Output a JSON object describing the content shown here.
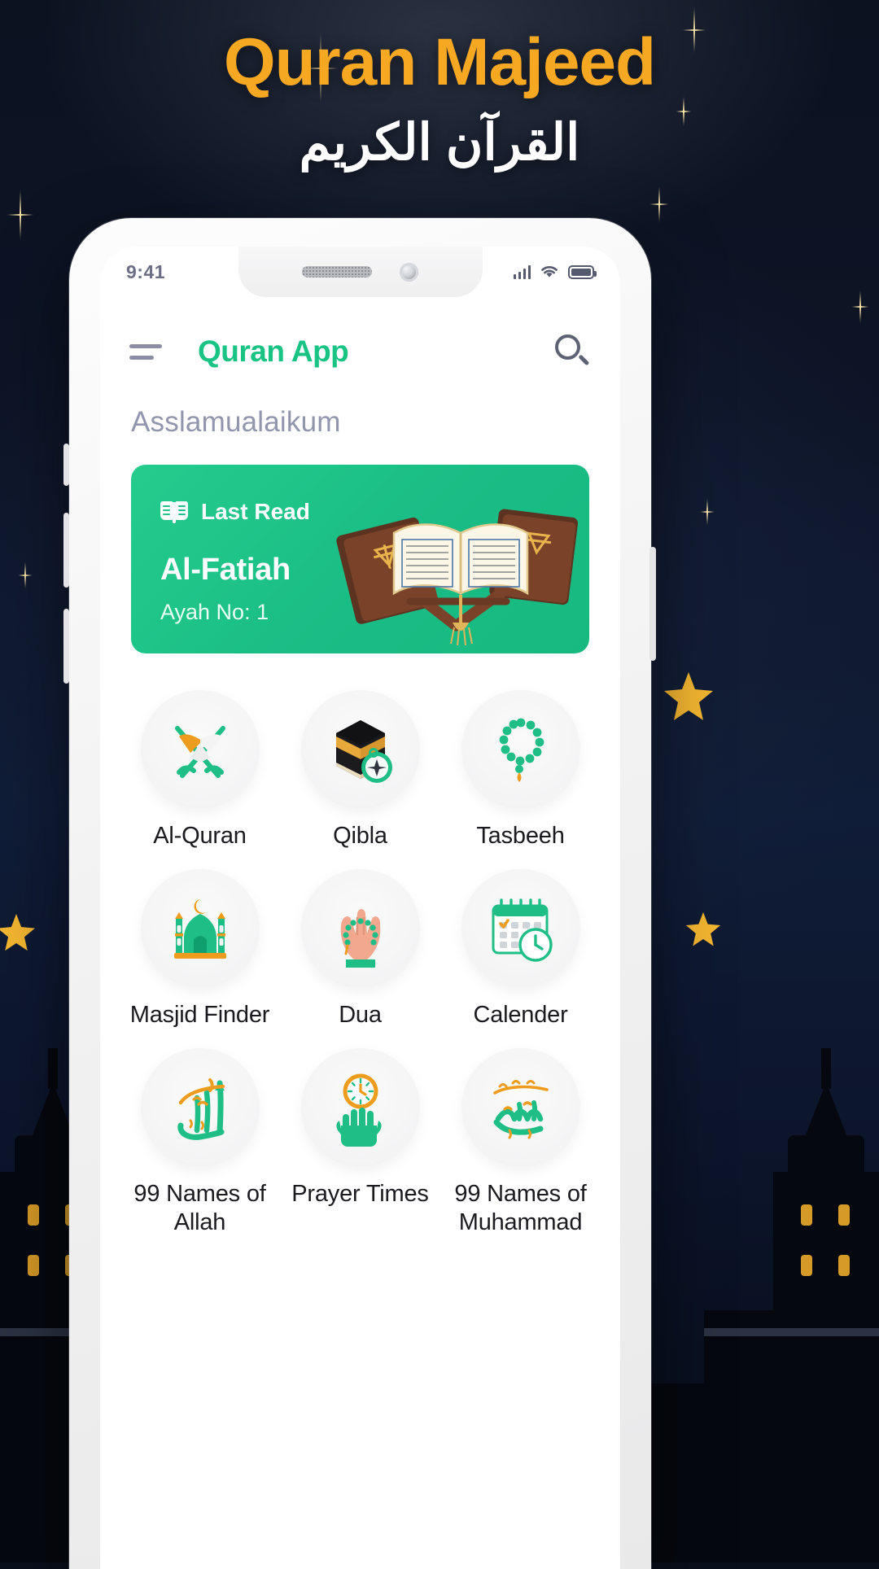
{
  "poster": {
    "title": "Quran Majeed",
    "subtitle": "القرآن الكريم",
    "title_color": "#F7A823",
    "subtitle_color": "#FFFFFF",
    "background_color": "#0b1328"
  },
  "phone": {
    "status_bar": {
      "time": "9:41",
      "icons": [
        "signal-icon",
        "wifi-icon",
        "battery-icon"
      ]
    },
    "app_bar": {
      "menu_icon": "hamburger-menu-icon",
      "title": "Quran App",
      "title_color": "#18C384",
      "search_icon": "search-icon"
    },
    "greeting": "Asslamualaikum",
    "last_read_card": {
      "icon": "open-book-icon",
      "label": "Last Read",
      "surah": "Al-Fatiah",
      "ayah": "Ayah No: 1",
      "background_color": "#19BD85",
      "art": "quran-on-rehal-icon"
    },
    "features": [
      {
        "label": "Al-Quran",
        "icon": "quran-rehal-icon"
      },
      {
        "label": "Qibla",
        "icon": "kaaba-compass-icon"
      },
      {
        "label": "Tasbeeh",
        "icon": "prayer-beads-icon"
      },
      {
        "label": "Masjid Finder",
        "icon": "mosque-icon"
      },
      {
        "label": "Dua",
        "icon": "praying-hands-beads-icon"
      },
      {
        "label": "Calender",
        "icon": "calendar-clock-icon"
      },
      {
        "label": "99 Names of Allah",
        "icon": "allah-calligraphy-icon"
      },
      {
        "label": "Prayer Times",
        "icon": "hands-clock-icon"
      },
      {
        "label": "99 Names of Muhammad",
        "icon": "muhammad-calligraphy-icon"
      }
    ]
  }
}
